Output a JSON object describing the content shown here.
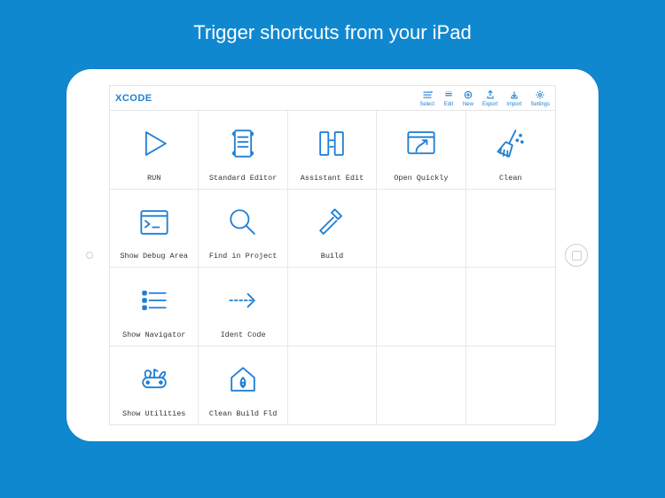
{
  "headline": "Trigger shortcuts from your iPad",
  "app_title": "XCODE",
  "toolbar": [
    {
      "label": "Select",
      "icon": "select-icon"
    },
    {
      "label": "Edit",
      "icon": "edit-icon"
    },
    {
      "label": "New",
      "icon": "new-icon"
    },
    {
      "label": "Export",
      "icon": "export-icon"
    },
    {
      "label": "Import",
      "icon": "import-icon"
    },
    {
      "label": "Settings",
      "icon": "settings-icon"
    }
  ],
  "grid": [
    {
      "label": "RUN",
      "icon": "play-icon"
    },
    {
      "label": "Standard Editor",
      "icon": "scroll-icon"
    },
    {
      "label": "Assistant Edit",
      "icon": "columns-icon"
    },
    {
      "label": "Open Quickly",
      "icon": "open-quickly-icon"
    },
    {
      "label": "Clean",
      "icon": "broom-icon"
    },
    {
      "label": "Show Debug Area",
      "icon": "terminal-icon"
    },
    {
      "label": "Find in Project",
      "icon": "magnify-icon"
    },
    {
      "label": "Build",
      "icon": "hammer-icon"
    },
    {
      "label": "",
      "icon": ""
    },
    {
      "label": "",
      "icon": ""
    },
    {
      "label": "Show Navigator",
      "icon": "list-icon"
    },
    {
      "label": "Ident Code",
      "icon": "indent-arrow-icon"
    },
    {
      "label": "",
      "icon": ""
    },
    {
      "label": "",
      "icon": ""
    },
    {
      "label": "",
      "icon": ""
    },
    {
      "label": "Show Utilities",
      "icon": "swiss-knife-icon"
    },
    {
      "label": "Clean Build Fld",
      "icon": "house-fire-icon"
    },
    {
      "label": "",
      "icon": ""
    },
    {
      "label": "",
      "icon": ""
    },
    {
      "label": "",
      "icon": ""
    }
  ],
  "colors": {
    "bg": "#1088d0",
    "accent": "#1f7fd4"
  }
}
